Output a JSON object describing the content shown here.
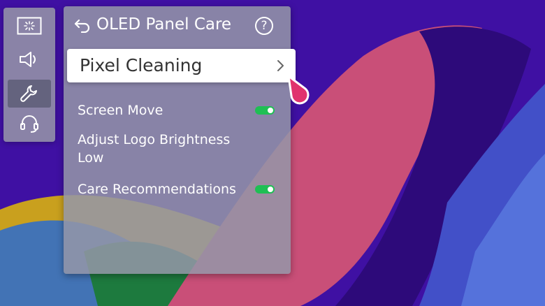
{
  "panel": {
    "title": "OLED Panel Care",
    "help_label": "?"
  },
  "rail": {
    "items": [
      {
        "icon": "picture-icon",
        "active": false
      },
      {
        "icon": "speaker-icon",
        "active": false
      },
      {
        "icon": "wrench-icon",
        "active": true
      },
      {
        "icon": "headset-icon",
        "active": false
      }
    ]
  },
  "menu": {
    "focused": {
      "label": "Pixel Cleaning",
      "icon": "chevron-right-icon"
    },
    "items": [
      {
        "label": "Screen Move",
        "toggle": true
      },
      {
        "label": "Adjust Logo Brightness",
        "value": "Low"
      },
      {
        "label": "Care Recommendations",
        "toggle": true
      }
    ]
  },
  "colors": {
    "toggle_on": "#1fbf54",
    "pointer": "#e0336e",
    "panel": "#9496a8"
  }
}
